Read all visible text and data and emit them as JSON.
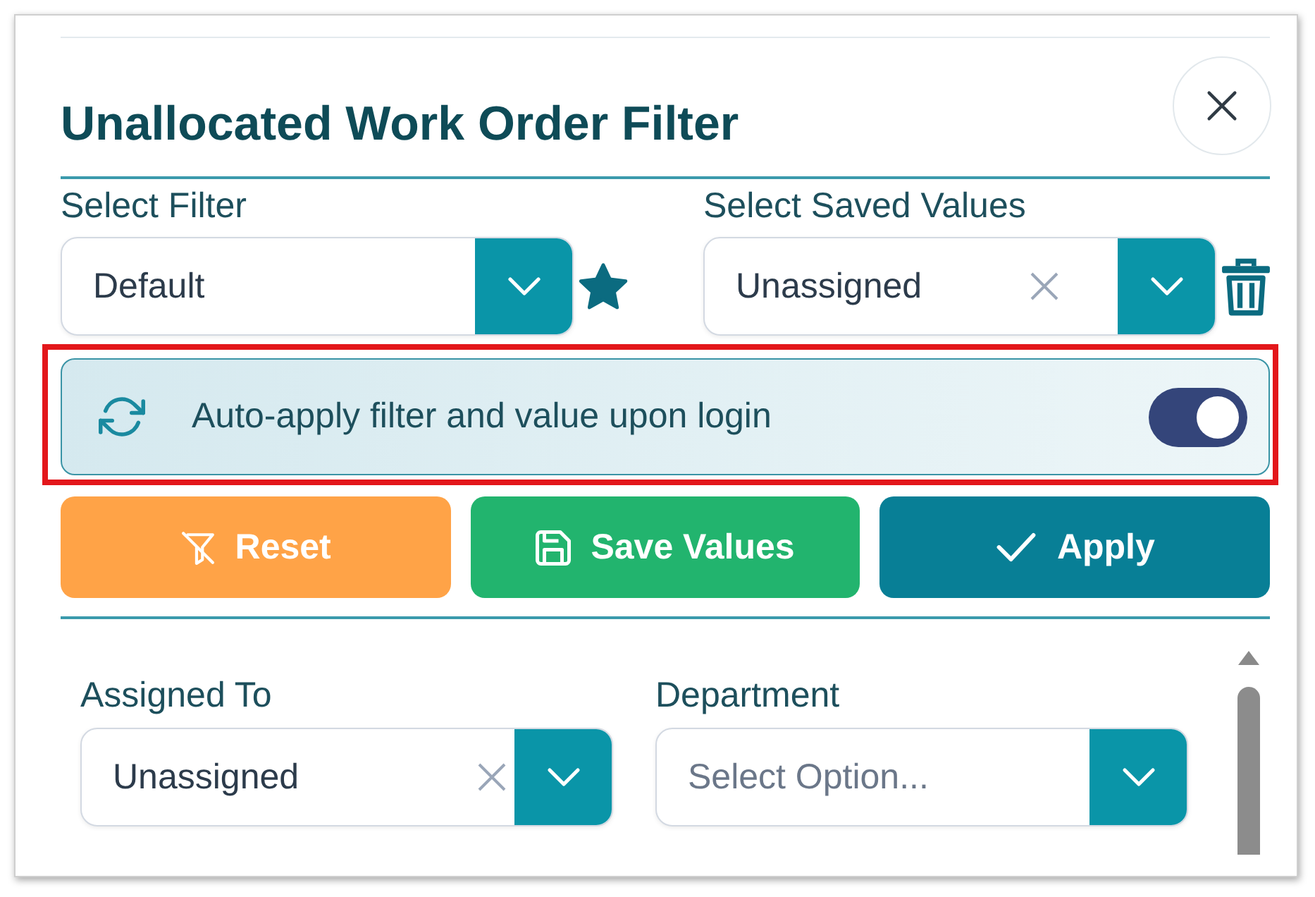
{
  "dialog": {
    "title": "Unallocated Work Order Filter"
  },
  "top_fields": [
    {
      "label": "Select Filter",
      "value": "Default",
      "clearable": false,
      "kind": "favorite"
    },
    {
      "label": "Select Saved Values",
      "value": "Unassigned",
      "clearable": true,
      "kind": "delete"
    }
  ],
  "auto_apply": {
    "label": "Auto-apply filter and value upon login",
    "on": true,
    "highlighted": true
  },
  "buttons": [
    {
      "label": "Reset",
      "kind": "reset"
    },
    {
      "label": "Save Values",
      "kind": "save"
    },
    {
      "label": "Apply",
      "kind": "apply"
    }
  ],
  "fields": [
    {
      "label": "Assigned To",
      "value": "Unassigned",
      "clearable": true
    },
    {
      "label": "Department",
      "placeholder": "Select Option...",
      "clearable": false
    }
  ]
}
